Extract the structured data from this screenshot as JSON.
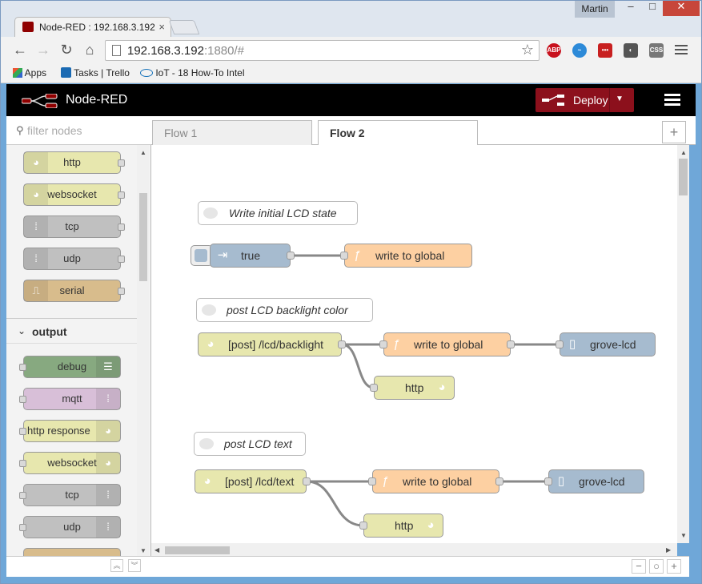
{
  "browser": {
    "tab_title": "Node-RED : 192.168.3.192",
    "user": "Martin",
    "url_host": "192.168.3.192",
    "url_rest": ":1880/#",
    "ext_abp": "ABP",
    "ext_css": "CSS",
    "bookmarks": [
      "Apps",
      "Tasks | Trello",
      "IoT - 18 How-To Intel"
    ]
  },
  "app": {
    "title": "Node-RED",
    "deploy_label": "Deploy",
    "header_color": "#000000",
    "deploy_color": "#8c101c"
  },
  "palette": {
    "filter_placeholder": "filter nodes",
    "input_nodes": [
      {
        "label": "http",
        "color": "#e7e7ae",
        "icon": "globe-icon"
      },
      {
        "label": "websocket",
        "color": "#e7e7ae",
        "icon": "globe-icon"
      },
      {
        "label": "tcp",
        "color": "#c0c0c0",
        "icon": "bridge-icon"
      },
      {
        "label": "udp",
        "color": "#c0c0c0",
        "icon": "bridge-icon"
      },
      {
        "label": "serial",
        "color": "#d8bc8c",
        "icon": "serial-icon"
      }
    ],
    "output_header": "output",
    "output_nodes": [
      {
        "label": "debug",
        "color": "#87a980",
        "icon": "debug-icon"
      },
      {
        "label": "mqtt",
        "color": "#d8bfd8",
        "icon": "bridge-icon"
      },
      {
        "label": "http response",
        "color": "#e7e7ae",
        "icon": "globe-icon"
      },
      {
        "label": "websocket",
        "color": "#e7e7ae",
        "icon": "globe-icon"
      },
      {
        "label": "tcp",
        "color": "#c0c0c0",
        "icon": "bridge-icon"
      },
      {
        "label": "udp",
        "color": "#c0c0c0",
        "icon": "bridge-icon"
      }
    ]
  },
  "tabs": [
    "Flow 1",
    "Flow 2"
  ],
  "flow": {
    "comments": [
      "Write initial LCD state",
      "post LCD backlight color",
      "post LCD text"
    ],
    "nodes": {
      "inject_true": "true",
      "fn1": "write to global",
      "http_backlight": "[post] /lcd/backlight",
      "fn2": "write to global",
      "lcd1": "grove-lcd",
      "http_resp1": "http",
      "http_text": "[post] /lcd/text",
      "fn3": "write to global",
      "lcd2": "grove-lcd",
      "http_resp2": "http"
    },
    "colors": {
      "inject": "#a6bbcf",
      "function": "#fdd0a2",
      "http": "#e7e7ae",
      "lcd": "#a6bbcf"
    }
  }
}
